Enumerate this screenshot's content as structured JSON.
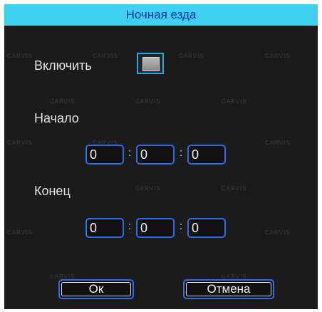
{
  "dialog": {
    "title": "Ночная езда"
  },
  "enable": {
    "label": "Включить",
    "checked": false
  },
  "start": {
    "label": "Начало",
    "hour": "0",
    "minute": "0",
    "second": "0"
  },
  "end": {
    "label": "Конец",
    "hour": "0",
    "minute": "0",
    "second": "0"
  },
  "separator": ":",
  "buttons": {
    "ok": "Ок",
    "cancel": "Отмена"
  },
  "watermark": "CARVIS",
  "colors": {
    "title_bar": "#3fd0ef",
    "title_text": "#0a35a8",
    "field_border": "#2b6fe8",
    "background": "#1b1b1b"
  }
}
